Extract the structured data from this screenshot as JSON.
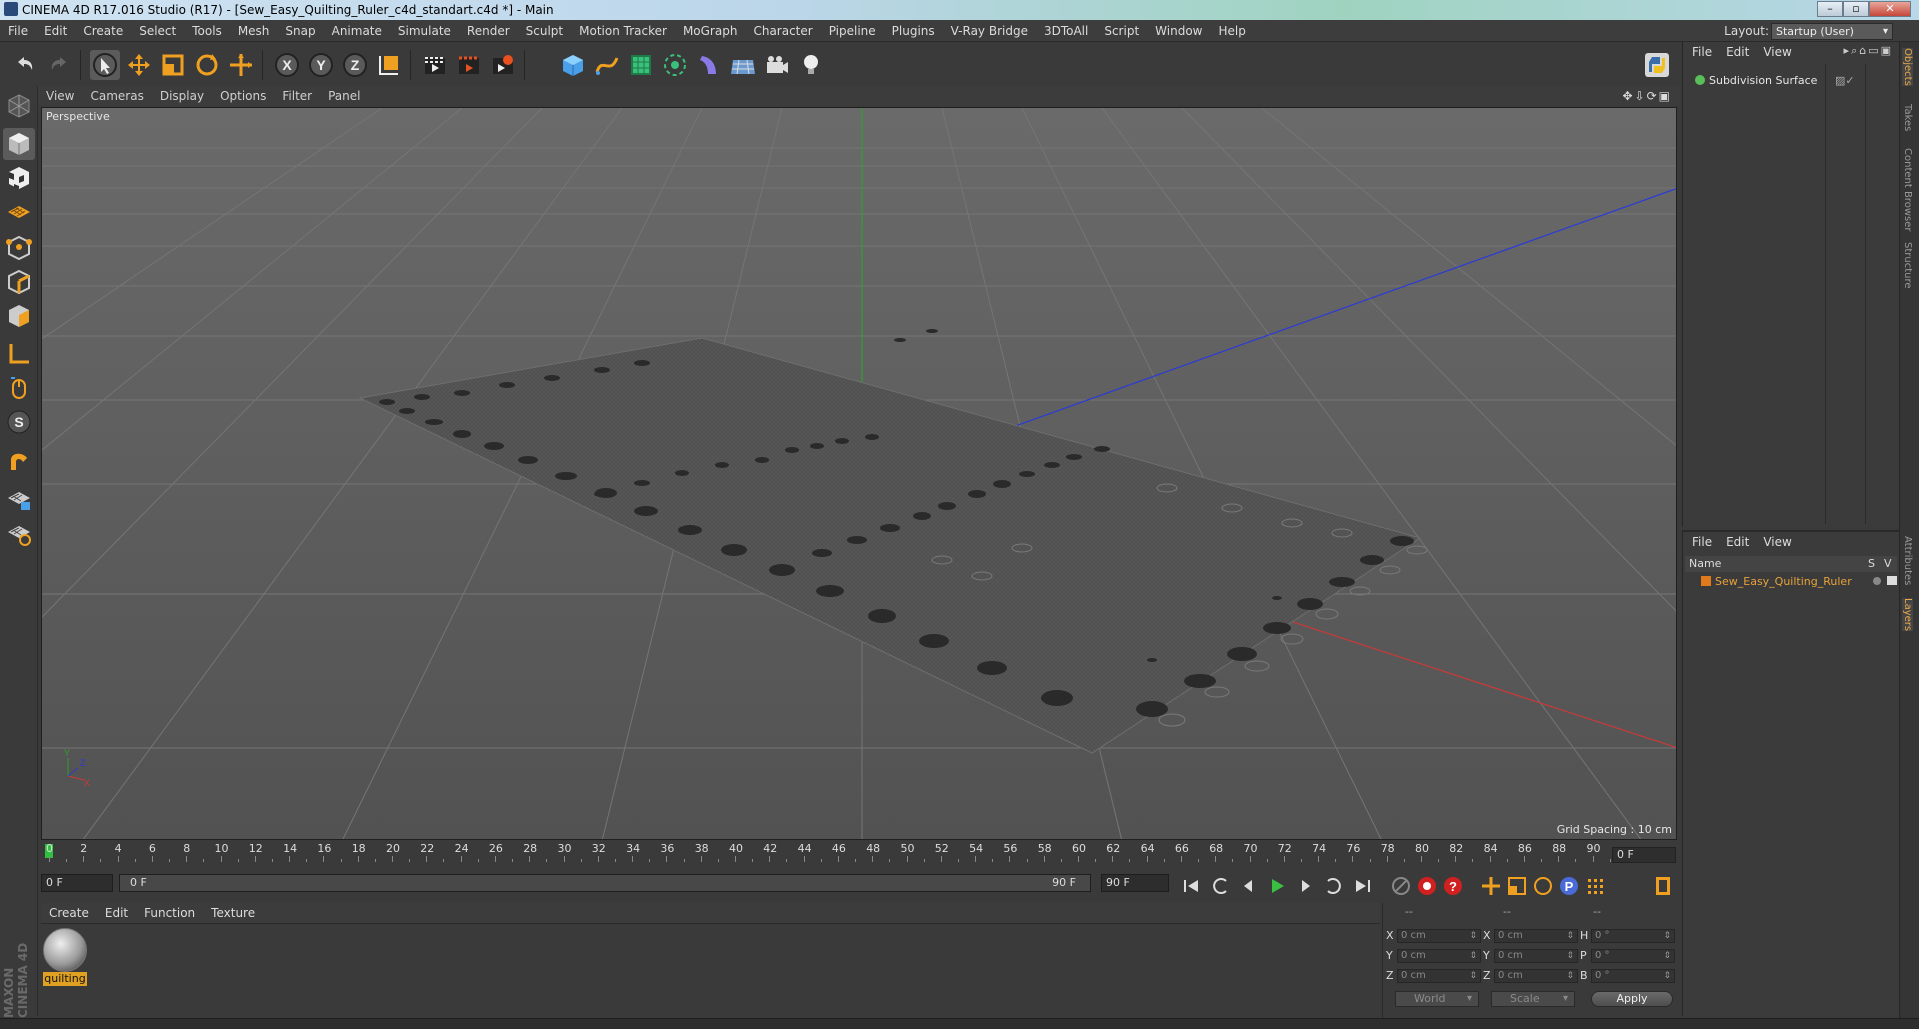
{
  "window": {
    "title": "CINEMA 4D R17.016 Studio (R17) - [Sew_Easy_Quilting_Ruler_c4d_standart.c4d *] - Main",
    "controls": [
      "minimize-icon",
      "maximize-icon",
      "close-icon"
    ]
  },
  "menubar": {
    "items": [
      "File",
      "Edit",
      "Create",
      "Select",
      "Tools",
      "Mesh",
      "Snap",
      "Animate",
      "Simulate",
      "Render",
      "Sculpt",
      "Motion Tracker",
      "MoGraph",
      "Character",
      "Pipeline",
      "Plugins",
      "V-Ray Bridge",
      "3DToAll",
      "Script",
      "Window",
      "Help"
    ],
    "layout_label": "Layout:",
    "layout_value": "Startup (User)"
  },
  "toolbar": {
    "icons": [
      "undo-icon",
      "redo-icon",
      "live-selection-icon",
      "move-icon",
      "scale-icon",
      "rotate-icon",
      "recent-tool-icon",
      "x-axis-lock-icon",
      "y-axis-lock-icon",
      "z-axis-lock-icon",
      "coordinate-system-icon",
      "render-view-icon",
      "render-picture-viewer-icon",
      "edit-render-settings-icon",
      "cube-object-icon",
      "pen-spline-icon",
      "subdivision-surface-icon",
      "array-icon",
      "deformer-icon",
      "floor-icon",
      "camera-icon",
      "light-icon",
      "python-icon"
    ]
  },
  "lefttools": {
    "icons": [
      "make-editable-icon",
      "model-mode-icon",
      "texture-mode-icon",
      "workplane-icon",
      "points-mode-icon",
      "edges-mode-icon",
      "polygons-mode-icon",
      "axis-mode-icon",
      "tweak-mode-icon",
      "solo-mode-icon",
      "snapping-icon",
      "workplane-lock-icon",
      "workplane-snap-icon"
    ]
  },
  "viewport": {
    "menu": [
      "View",
      "Cameras",
      "Display",
      "Options",
      "Filter",
      "Panel"
    ],
    "label": "Perspective",
    "grid_spacing": "Grid Spacing : 10 cm",
    "axis_labels": {
      "y": "Y",
      "x": "X",
      "z": "Z"
    }
  },
  "timeline": {
    "ticks": [
      "0",
      "2",
      "4",
      "6",
      "8",
      "10",
      "12",
      "14",
      "16",
      "18",
      "20",
      "22",
      "24",
      "26",
      "28",
      "30",
      "32",
      "34",
      "36",
      "38",
      "40",
      "42",
      "44",
      "46",
      "48",
      "50",
      "52",
      "54",
      "56",
      "58",
      "60",
      "62",
      "64",
      "66",
      "68",
      "70",
      "72",
      "74",
      "76",
      "78",
      "80",
      "82",
      "84",
      "86",
      "88",
      "90"
    ],
    "end_field": "0 F",
    "current_frame": "0 F",
    "range_start": "0 F",
    "range_end": "90 F",
    "max_frame": "90 F"
  },
  "material_manager": {
    "menu": [
      "Create",
      "Edit",
      "Function",
      "Texture"
    ],
    "material_name": "quilting"
  },
  "coordinates": {
    "header": [
      "--",
      "--",
      "--"
    ],
    "rows": [
      {
        "a": "X",
        "av": "0 cm",
        "b": "X",
        "bv": "0 cm",
        "c": "H",
        "cv": "0 °"
      },
      {
        "a": "Y",
        "av": "0 cm",
        "b": "Y",
        "bv": "0 cm",
        "c": "P",
        "cv": "0 °"
      },
      {
        "a": "Z",
        "av": "0 cm",
        "b": "Z",
        "bv": "0 cm",
        "c": "B",
        "cv": "0 °"
      }
    ],
    "mode": "World",
    "transform": "Scale",
    "apply": "Apply"
  },
  "object_manager": {
    "menu": [
      "File",
      "Edit",
      "View"
    ],
    "object": "Subdivision Surface"
  },
  "layer_manager": {
    "menu": [
      "File",
      "Edit",
      "View"
    ],
    "col_name": "Name",
    "col_s": "S",
    "col_v": "V",
    "layer": "Sew_Easy_Quilting_Ruler"
  },
  "side_tabs": [
    "Objects",
    "Takes",
    "Content Browser",
    "Structure",
    "Attributes",
    "Layers"
  ],
  "branding": "MAXON CINEMA 4D"
}
